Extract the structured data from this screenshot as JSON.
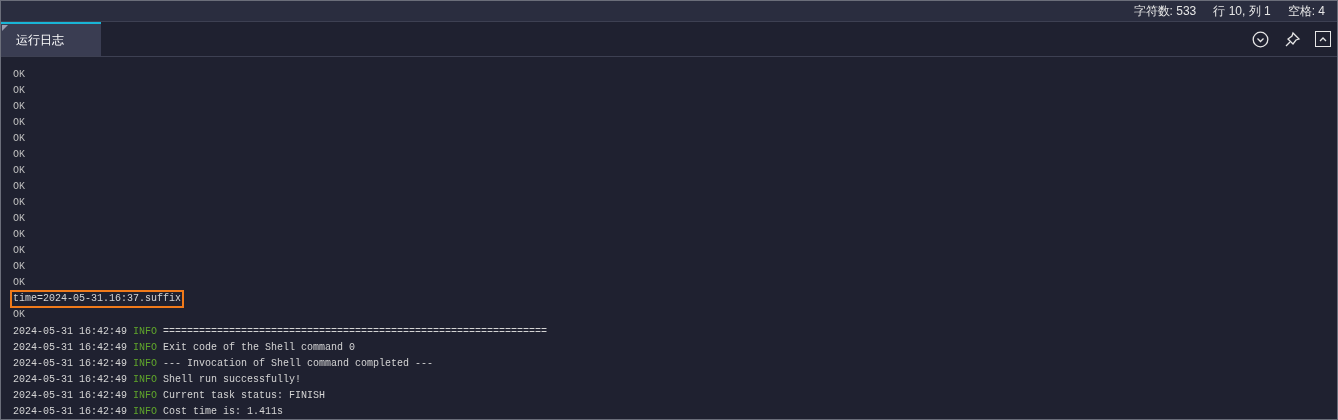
{
  "status_bar": {
    "items": [
      "字符数: 533",
      "行 10, 列 1",
      "空格: 4"
    ]
  },
  "tabs": [
    {
      "label": "运行日志",
      "selected": true
    }
  ],
  "log": [
    {
      "kind": "plain",
      "text": "OK",
      "highlighted": false
    },
    {
      "kind": "plain",
      "text": "OK",
      "highlighted": false
    },
    {
      "kind": "plain",
      "text": "OK",
      "highlighted": false
    },
    {
      "kind": "plain",
      "text": "OK",
      "highlighted": false
    },
    {
      "kind": "plain",
      "text": "OK",
      "highlighted": false
    },
    {
      "kind": "plain",
      "text": "OK",
      "highlighted": false
    },
    {
      "kind": "plain",
      "text": "OK",
      "highlighted": false
    },
    {
      "kind": "plain",
      "text": "OK",
      "highlighted": false
    },
    {
      "kind": "plain",
      "text": "OK",
      "highlighted": false
    },
    {
      "kind": "plain",
      "text": "OK",
      "highlighted": false
    },
    {
      "kind": "plain",
      "text": "OK",
      "highlighted": false
    },
    {
      "kind": "plain",
      "text": "OK",
      "highlighted": false
    },
    {
      "kind": "plain",
      "text": "OK",
      "highlighted": false
    },
    {
      "kind": "plain",
      "text": "OK",
      "highlighted": false
    },
    {
      "kind": "plain",
      "text": "time=2024-05-31.16:37.suffix",
      "highlighted": true
    },
    {
      "kind": "plain",
      "text": "OK",
      "highlighted": false
    },
    {
      "kind": "info",
      "timestamp": "2024-05-31 16:42:49",
      "level": "INFO",
      "message": "================================================================"
    },
    {
      "kind": "info",
      "timestamp": "2024-05-31 16:42:49",
      "level": "INFO",
      "message": "Exit code of the Shell command 0"
    },
    {
      "kind": "info",
      "timestamp": "2024-05-31 16:42:49",
      "level": "INFO",
      "message": "--- Invocation of Shell command completed ---"
    },
    {
      "kind": "info",
      "timestamp": "2024-05-31 16:42:49",
      "level": "INFO",
      "message": "Shell run successfully!"
    },
    {
      "kind": "info",
      "timestamp": "2024-05-31 16:42:49",
      "level": "INFO",
      "message": "Current task status: FINISH"
    },
    {
      "kind": "info",
      "timestamp": "2024-05-31 16:42:49",
      "level": "INFO",
      "message": "Cost time is: 1.411s"
    }
  ]
}
